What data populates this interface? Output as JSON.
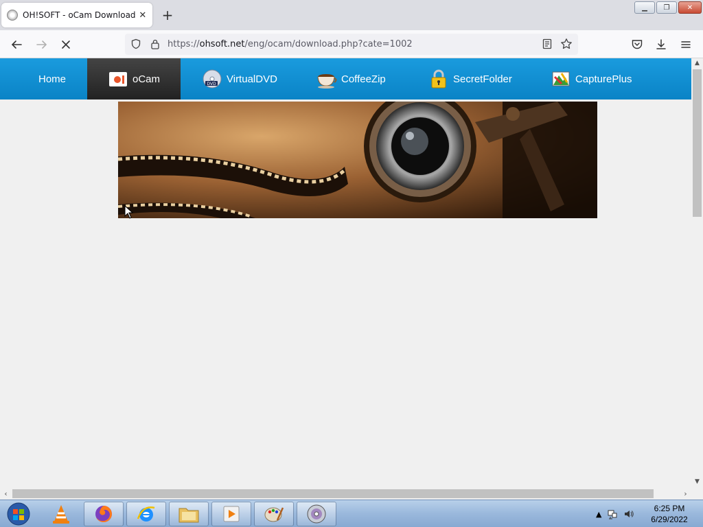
{
  "browser": {
    "tab": {
      "title": "OH!SOFT - oCam Download",
      "close_glyph": "✕"
    },
    "new_tab_glyph": "+",
    "window_controls": {
      "minimize": "▁",
      "restore": "❐",
      "close": "✕"
    },
    "url": {
      "scheme": "https://",
      "host": "ohsoft.net",
      "path": "/eng/ocam/download.php?cate=1002"
    },
    "icons": [
      "back-icon",
      "forward-icon",
      "stop-loading-icon",
      "shield-icon",
      "lock-icon",
      "reader-view-icon",
      "bookmark-star-icon",
      "pocket-icon",
      "downloads-icon",
      "menu-icon"
    ]
  },
  "site_nav": {
    "items": [
      {
        "label": "Home",
        "icon": ""
      },
      {
        "label": "oCam",
        "icon": "ocam-icon",
        "active": true
      },
      {
        "label": "VirtualDVD",
        "icon": "dvd-icon"
      },
      {
        "label": "CoffeeZip",
        "icon": "coffee-cup-icon"
      },
      {
        "label": "SecretFolder",
        "icon": "padlock-icon"
      },
      {
        "label": "CapturePlus",
        "icon": "capture-plus-icon"
      }
    ]
  },
  "banner": {
    "subject": "vintage-camera-film-image"
  },
  "taskbar": {
    "apps": [
      "start-orb-icon",
      "vlc-icon",
      "firefox-icon",
      "internet-explorer-icon",
      "file-explorer-icon",
      "media-player-icon",
      "paint-icon",
      "dvd-disc-icon"
    ],
    "clock": {
      "time": "6:25 PM",
      "date": "6/29/2022"
    }
  },
  "colors": {
    "nav_blue": "#1a9bde",
    "nav_active": "#333333",
    "tab_bg": "#ffffff"
  }
}
